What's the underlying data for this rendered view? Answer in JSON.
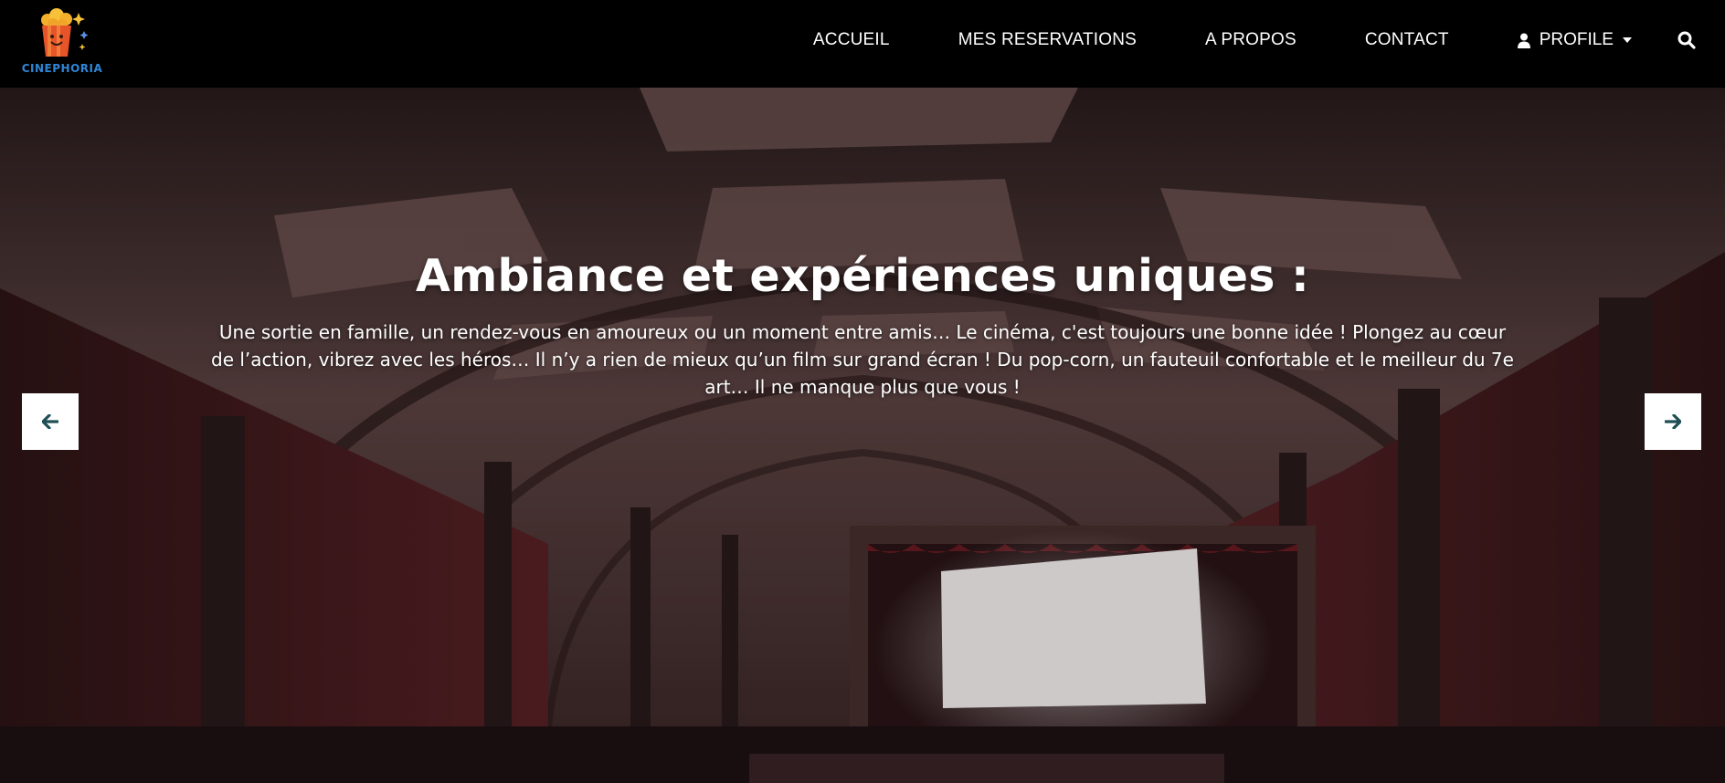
{
  "brand": {
    "name": "CINEPHORIA",
    "logo_icon": "popcorn-bucket-icon"
  },
  "nav": {
    "items": [
      {
        "label": "ACCUEIL"
      },
      {
        "label": "MES RESERVATIONS"
      },
      {
        "label": "A PROPOS"
      },
      {
        "label": "CONTACT"
      }
    ],
    "profile": {
      "label": "PROFILE",
      "icon": "user-icon"
    },
    "search_icon": "search-icon"
  },
  "hero": {
    "title": "Ambiance et expériences uniques :",
    "description": "Une sortie en famille, un rendez-vous en amoureux ou un moment entre amis… Le cinéma, c'est toujours une bonne idée ! Plongez au cœur de l’action, vibrez avec les héros… Il n’y a rien de mieux qu’un film sur grand écran ! Du pop-corn, un fauteuil confortable et le meilleur du 7e art… Il ne manque plus que vous !",
    "prev_icon": "arrow-left-icon",
    "next_icon": "arrow-right-icon"
  },
  "colors": {
    "navbar_bg": "#000000",
    "brand_text": "#2f86d6",
    "arrow_color": "#1f4f55",
    "hero_wall": "#5a1f24"
  }
}
